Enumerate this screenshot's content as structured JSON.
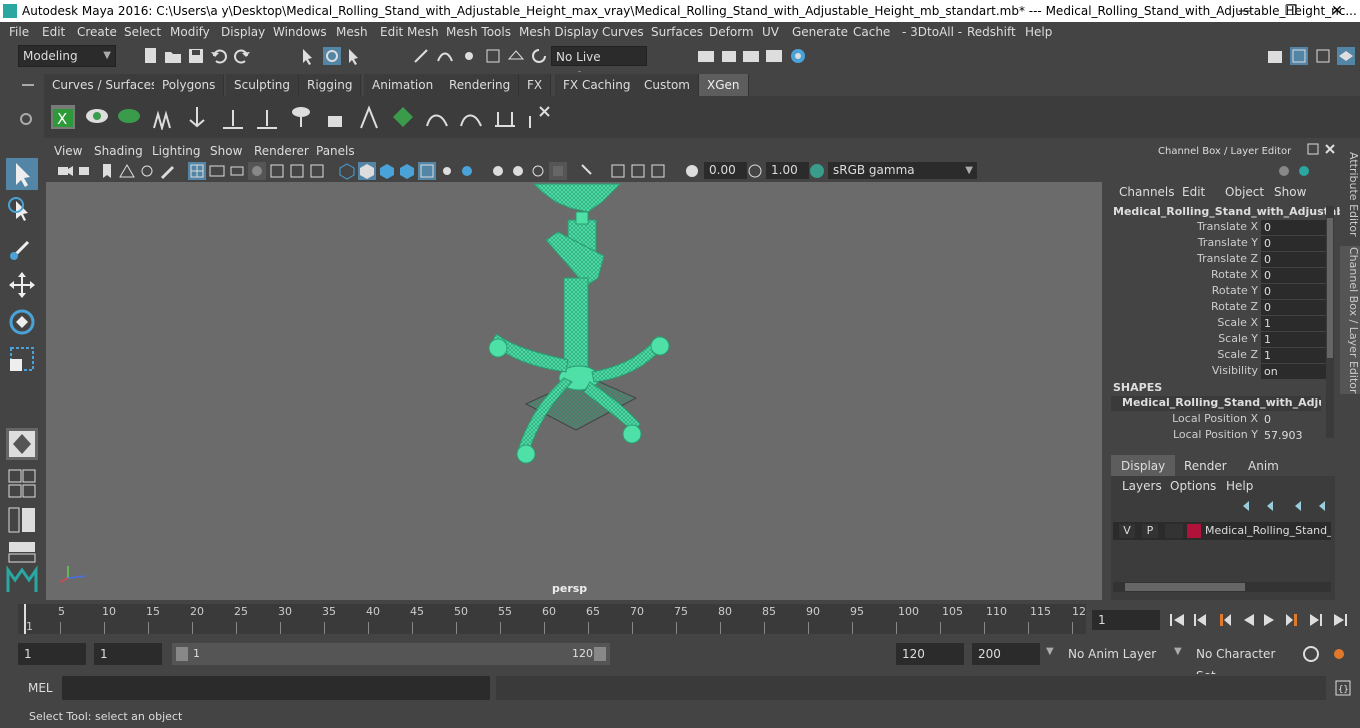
{
  "window": {
    "title": "Autodesk Maya 2016: C:\\Users\\a y\\Desktop\\Medical_Rolling_Stand_with_Adjustable_Height_max_vray\\Medical_Rolling_Stand_with_Adjustable_Height_mb_standart.mb*   ---   Medical_Rolling_Stand_with_Adjustable_Height_nc...",
    "minimize": "—",
    "maximize": "❐",
    "close": "✕"
  },
  "menubar": [
    "File",
    "Edit",
    "Create",
    "Select",
    "Modify",
    "Display",
    "Windows",
    "Mesh",
    "Edit Mesh",
    "Mesh Tools",
    "Mesh Display",
    "Curves",
    "Surfaces",
    "Deform",
    "UV",
    "Generate",
    "Cache",
    "- 3DtoAll -",
    "Redshift",
    "Help"
  ],
  "statusline": {
    "mode": "Modeling",
    "live_surface": "No Live Surface"
  },
  "shelf_tabs": [
    "Curves / Surfaces",
    "Polygons",
    "Sculpting",
    "Rigging",
    "Animation",
    "Rendering",
    "FX",
    "FX Caching",
    "Custom",
    "XGen"
  ],
  "shelf_active": "XGen",
  "viewport": {
    "menu": [
      "View",
      "Shading",
      "Lighting",
      "Show",
      "Renderer",
      "Panels"
    ],
    "exposure": "0.00",
    "gamma": "1.00",
    "colorspace": "sRGB gamma",
    "camera": "persp",
    "colors": {
      "wire": "#4fe0a8",
      "wire_dark": "#2a9c72",
      "bg": "#6b6b6b"
    }
  },
  "channelbox": {
    "title": "Channel Box / Layer Editor",
    "menu": [
      "Channels",
      "Edit",
      "Object",
      "Show"
    ],
    "object": "Medical_Rolling_Stand_with_Adjustab...",
    "attributes": [
      {
        "label": "Translate X",
        "value": "0"
      },
      {
        "label": "Translate Y",
        "value": "0"
      },
      {
        "label": "Translate Z",
        "value": "0"
      },
      {
        "label": "Rotate X",
        "value": "0"
      },
      {
        "label": "Rotate Y",
        "value": "0"
      },
      {
        "label": "Rotate Z",
        "value": "0"
      },
      {
        "label": "Scale X",
        "value": "1"
      },
      {
        "label": "Scale Y",
        "value": "1"
      },
      {
        "label": "Scale Z",
        "value": "1"
      },
      {
        "label": "Visibility",
        "value": "on"
      }
    ],
    "shapes_header": "SHAPES",
    "shape_name": "Medical_Rolling_Stand_with_Adjust...",
    "shape_attributes": [
      {
        "label": "Local Position X",
        "value": "0"
      },
      {
        "label": "Local Position Y",
        "value": "57.903"
      }
    ]
  },
  "side_tabs": {
    "attribute_editor": "Attribute Editor",
    "channel_box": "Channel Box / Layer Editor"
  },
  "layer_editor": {
    "tabs": [
      "Display",
      "Render",
      "Anim"
    ],
    "menu": [
      "Layers",
      "Options",
      "Help"
    ],
    "layer": {
      "v": "V",
      "p": "P",
      "name": "Medical_Rolling_Stand_v",
      "color": "#b0123a"
    }
  },
  "timeline": {
    "ticks": [
      "5",
      "10",
      "15",
      "20",
      "25",
      "30",
      "35",
      "40",
      "45",
      "50",
      "55",
      "60",
      "65",
      "70",
      "75",
      "80",
      "85",
      "90",
      "95",
      "100",
      "105",
      "110",
      "115",
      "12"
    ],
    "start_marker": "1",
    "current_frame": "1"
  },
  "range": {
    "start": "1",
    "anim_start": "1",
    "slider_start": "1",
    "slider_end": "120",
    "end": "120",
    "anim_end": "200",
    "anim_layer": "No Anim Layer",
    "character_set": "No Character Set"
  },
  "mel": {
    "label": "MEL"
  },
  "help": {
    "text": "Select Tool: select an object"
  }
}
